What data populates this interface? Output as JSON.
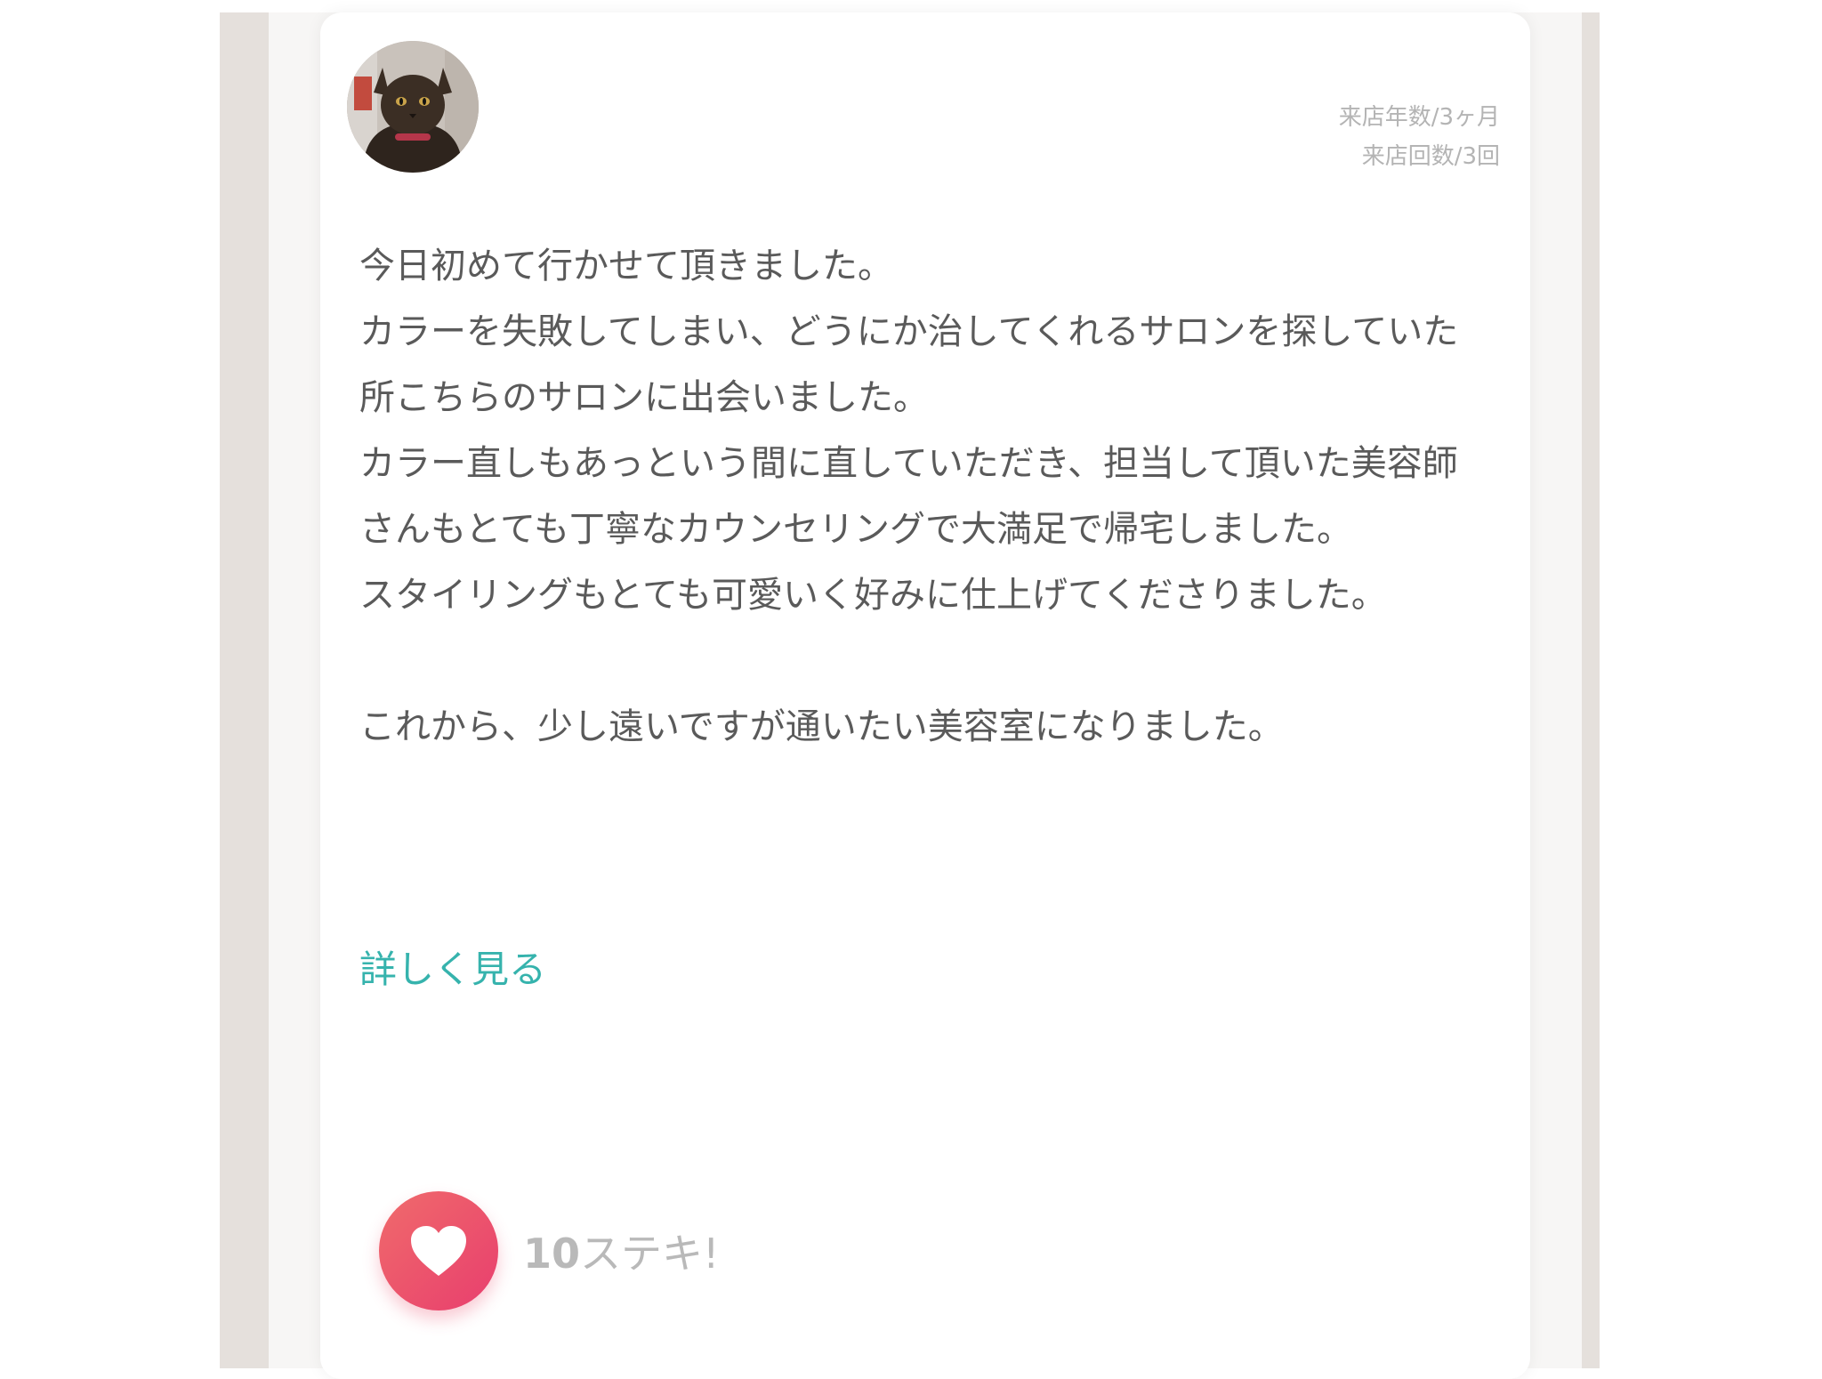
{
  "reviewer": {
    "avatar_icon": "cat-avatar-icon",
    "visit_years": "来店年数/3ヶ月",
    "visit_count": "来店回数/3回"
  },
  "review": {
    "paragraphs": [
      "今日初めて行かせて頂きました。",
      "カラーを失敗してしまい、どうにか治してくれるサロンを探していた所こちらのサロンに出会いました。",
      "カラー直しもあっという間に直していただき、担当して頂いた美容師さんもとても丁寧なカウンセリングで大満足で帰宅しました。",
      "スタイリングもとても可愛いく好みに仕上げてくださりました。",
      "",
      "これから、少し遠いですが通いたい美容室になりました。"
    ],
    "more_label": "詳しく見る"
  },
  "reaction": {
    "icon": "heart-icon",
    "count": "10",
    "label": "ステキ!"
  },
  "colors": {
    "accent_link": "#36b3ad",
    "like_button": "#ec5570",
    "backdrop": "#e5e0dc"
  }
}
